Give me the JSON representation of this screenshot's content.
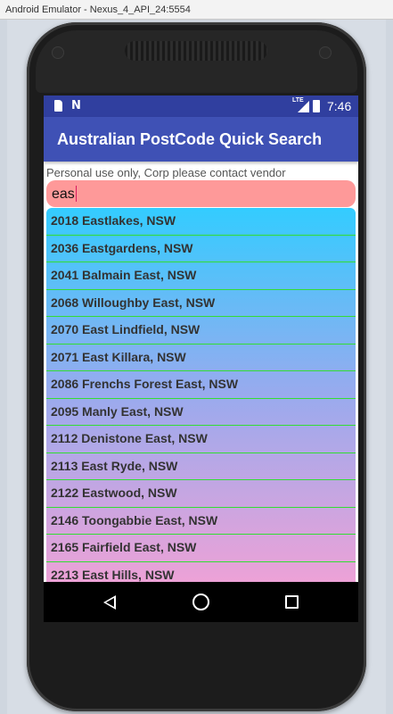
{
  "window": {
    "title": "Android Emulator - Nexus_4_API_24:5554"
  },
  "status_bar": {
    "icons": [
      "sd-card-icon",
      "n-notification-icon",
      "lte-icon",
      "signal-icon",
      "battery-icon"
    ],
    "lte_label": "LTE",
    "time": "7:46"
  },
  "app_bar": {
    "title": "Australian PostCode Quick Search",
    "color": "#3f51b5"
  },
  "notice": "Personal use only, Corp please contact vendor",
  "search": {
    "value": "eas",
    "background": "#fe9999"
  },
  "results": [
    "2018 Eastlakes, NSW",
    "2036 Eastgardens, NSW",
    "2041 Balmain East, NSW",
    "2068 Willoughby East, NSW",
    "2070 East Lindfield, NSW",
    "2071 East Killara, NSW",
    "2086 Frenchs Forest East, NSW",
    "2095 Manly East, NSW",
    "2112 Denistone East, NSW",
    "2113 East Ryde, NSW",
    "2122 Eastwood, NSW",
    "2146 Toongabbie East, NSW",
    "2165 Fairfield East, NSW",
    "2213 East Hills, NSW"
  ],
  "nav_bar": {
    "buttons": [
      "back-icon",
      "home-icon",
      "recents-icon"
    ]
  }
}
